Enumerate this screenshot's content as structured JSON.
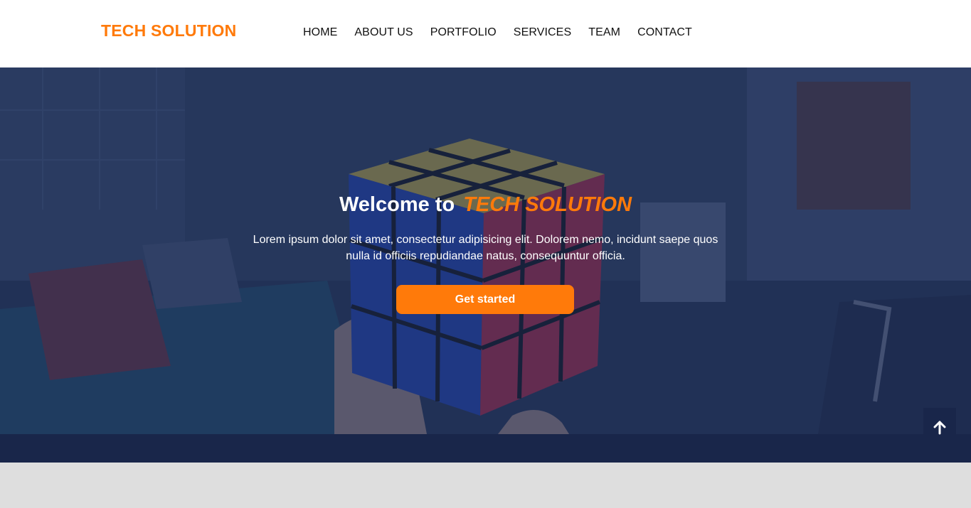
{
  "header": {
    "logo": "TECH SOLUTION",
    "nav": [
      {
        "label": "HOME"
      },
      {
        "label": "ABOUT US"
      },
      {
        "label": "PORTFOLIO"
      },
      {
        "label": "SERVICES"
      },
      {
        "label": "TEAM"
      },
      {
        "label": "CONTACT"
      }
    ]
  },
  "hero": {
    "title_prefix": "Welcome to",
    "title_brand": "TECH SOLUTION",
    "text": "Lorem ipsum dolor sit amet, consectetur adipisicing elit. Dolorem nemo, incidunt saepe quos nulla id officiis repudiandae natus, consequuntur officia.",
    "cta_label": "Get started"
  },
  "icons": {
    "back_to_top": "arrow-up-icon"
  },
  "colors": {
    "accent": "#ff7a0a",
    "navy": "#19264a",
    "overlay": "#162750",
    "gray": "#dedede"
  }
}
